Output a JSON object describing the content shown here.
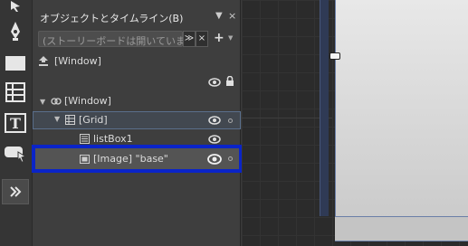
{
  "panel": {
    "title": "オブジェクトとタイムライン(B)",
    "pin": "▼",
    "close": "×",
    "search_placeholder": "(ストーリーボードは開いていません)",
    "dropdown_btn": "≫",
    "clear_btn": "×",
    "add_btn": "+",
    "add_caret": "▼"
  },
  "root": {
    "label": "[Window]"
  },
  "tree": {
    "window": "[Window]",
    "grid": "[Grid]",
    "listbox": "listBox1",
    "image": "[Image] \"base\""
  },
  "colors": {
    "highlight": "#0a24c8",
    "selection_border": "#5a6f8c"
  }
}
